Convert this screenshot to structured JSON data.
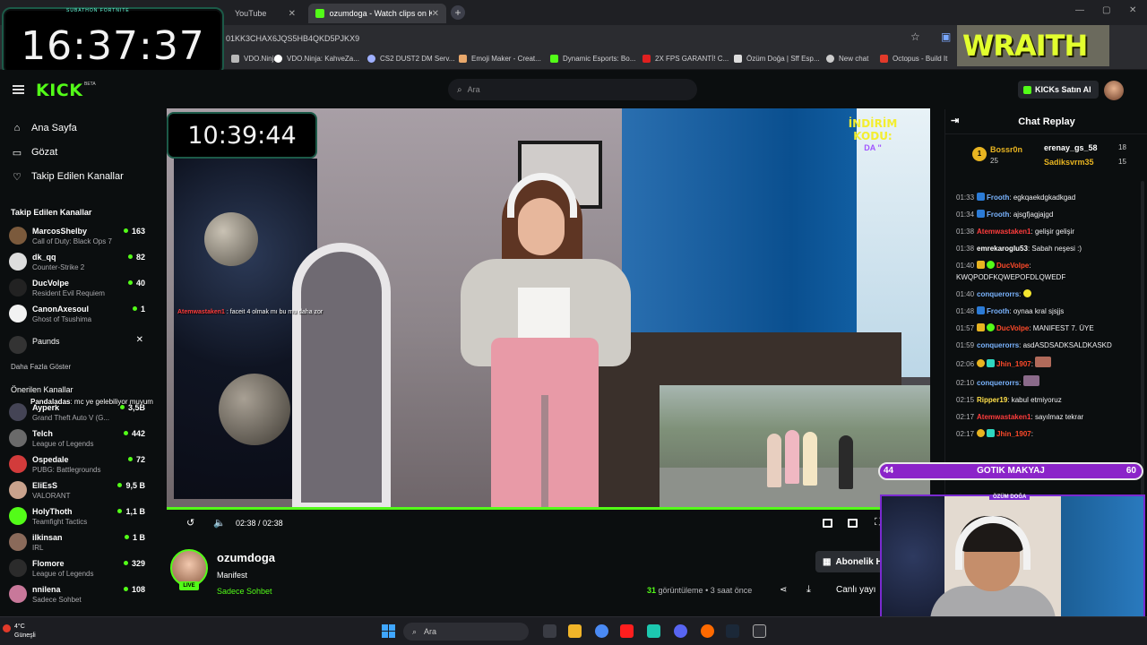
{
  "browser": {
    "tabs": [
      {
        "title": "YouTube",
        "active": false
      },
      {
        "title": "ozumdoga - Watch clips on Ki",
        "active": true
      }
    ],
    "url": "01KK3CHAX6JQS5HB4QKD5PJKX9",
    "bookmarks": [
      "VDO.Ninja",
      "VDO.Ninja: KahveZa...",
      "CS2 DUST2 DM Serv...",
      "Emoji Maker - Creat...",
      "Dynamic Esports: Bo...",
      "2X FPS GARANTİ! C...",
      "Özüm Doğa | Sff Esp...",
      "New chat",
      "Octopus - Build It"
    ]
  },
  "overlays": {
    "clock_top": "16:37:37",
    "clock_top_label": "SUBATHON FORTNITE",
    "logo_text": "WRAITH",
    "clock_player": "10:39:44",
    "promo_line1": "İNDİRİM KODU:",
    "promo_line2": "DA \""
  },
  "header": {
    "logo": "KICK",
    "logo_tag": "BETA",
    "search_placeholder": "Ara",
    "buy_label": "KICKs Satın Al"
  },
  "sidebar": {
    "nav": [
      {
        "label": "Ana Sayfa",
        "icon": "home-icon"
      },
      {
        "label": "Gözat",
        "icon": "compass-icon"
      },
      {
        "label": "Takip Edilen Kanallar",
        "icon": "heart-icon"
      }
    ],
    "followed_title": "Takip Edilen Kanallar",
    "followed": [
      {
        "name": "MarcosShelby",
        "game": "Call of Duty: Black Ops 7",
        "viewers": "163"
      },
      {
        "name": "dk_qq",
        "game": "Counter-Strike 2",
        "viewers": "82"
      },
      {
        "name": "DucVolpe",
        "game": "Resident Evil Requiem",
        "viewers": "40"
      },
      {
        "name": "CanonAxesoul",
        "game": "Ghost of Tsushima",
        "viewers": "1"
      },
      {
        "name": "Paunds",
        "game": "",
        "viewers": ""
      }
    ],
    "show_more": "Daha Fazla Göster",
    "recommended_title": "Önerilen Kanallar",
    "recommended": [
      {
        "name": "Ayperk",
        "game": "Grand Theft Auto V (G...",
        "viewers": "3,5B"
      },
      {
        "name": "Telch",
        "game": "League of Legends",
        "viewers": "442"
      },
      {
        "name": "Ospedale",
        "game": "PUBG: Battlegrounds",
        "viewers": "72"
      },
      {
        "name": "EliEsS",
        "game": "VALORANT",
        "viewers": "9,5 B"
      },
      {
        "name": "HolyThoth",
        "game": "Teamfight Tactics",
        "viewers": "1,1 B"
      },
      {
        "name": "ilkinsan",
        "game": "IRL",
        "viewers": "1 B"
      },
      {
        "name": "Flomore",
        "game": "League of Legends",
        "viewers": "329"
      },
      {
        "name": "nnilena",
        "game": "Sadece Sohbet",
        "viewers": "108"
      }
    ],
    "floating_chat_user": "Pandaladas",
    "floating_chat_text": ": mc ye gelebiliyor muyum"
  },
  "player": {
    "overlay_chat_user": "Atemwastaken1",
    "overlay_chat_text": ": faceit 4 olmak mı bu mu daha zor",
    "time_current": "02:38",
    "time_sep": "/",
    "time_total": "02:38",
    "progress": 1.0
  },
  "video_info": {
    "channel": "ozumdoga",
    "title": "Manifest",
    "category": "Sadece Sohbet",
    "live_badge": "LIVE",
    "views_count": "31",
    "views_label": "görüntüleme",
    "ago": "• 3 saat önce",
    "subscribe_label": "Abonelik H",
    "live_link": "Canlı yayı"
  },
  "chat": {
    "title": "Chat Replay",
    "top_gifters": [
      {
        "name": "Bossr0n",
        "count": "25",
        "color": "#e8b421"
      },
      {
        "name": "erenay_gs_58",
        "count": "18",
        "color": "#ffffff"
      },
      {
        "name": "Sadiksvrm35",
        "count": "15",
        "color": "#e8b421"
      }
    ],
    "messages": [
      {
        "ts": "01:33",
        "user": "Frooth",
        "color": "#7ab4ff",
        "text": "egkqaekdgkadkgad"
      },
      {
        "ts": "01:34",
        "user": "Frooth",
        "color": "#7ab4ff",
        "text": "ajsgfjagjajgd"
      },
      {
        "ts": "01:38",
        "user": "Atemwastaken1",
        "color": "#ff3c3c",
        "text": "gelişir gelişir"
      },
      {
        "ts": "01:38",
        "user": "emrekaroglu53",
        "color": "#ffffff",
        "text": "Sabah neşesi :)"
      },
      {
        "ts": "01:40",
        "user": "DucVolpe",
        "color": "#ff4a2a",
        "text": "KWQPODFKQWEPOFDLQWEDF"
      },
      {
        "ts": "01:40",
        "user": "conquerorrs",
        "color": "#7ab4ff",
        "text": ""
      },
      {
        "ts": "01:48",
        "user": "Frooth",
        "color": "#7ab4ff",
        "text": "oynaa kral sjsjjs"
      },
      {
        "ts": "01:57",
        "user": "DucVolpe",
        "color": "#ff4a2a",
        "text": "MANIFEST 7. ÜYE"
      },
      {
        "ts": "01:59",
        "user": "conquerorrs",
        "color": "#7ab4ff",
        "text": "asdASDSADKSALDKASKD"
      },
      {
        "ts": "02:06",
        "user": "Jhin_1907",
        "color": "#ff4a2a",
        "text": ""
      },
      {
        "ts": "02:10",
        "user": "conquerorrs",
        "color": "#7ab4ff",
        "text": ""
      },
      {
        "ts": "02:15",
        "user": "Ripper19",
        "color": "#ffe04a",
        "text": "kabul etmiyoruz"
      },
      {
        "ts": "02:17",
        "user": "Atemwastaken1",
        "color": "#ff3c3c",
        "text": "sayılmaz tekrar"
      },
      {
        "ts": "02:17",
        "user": "Jhin_1907",
        "color": "#ff4a2a",
        "text": ""
      }
    ]
  },
  "goal": {
    "left": "44",
    "label": "GOTIK MAKYAJ",
    "right": "60"
  },
  "cam_label": "ÖZÜM DOĞA",
  "taskbar": {
    "temp": "4°C",
    "weather": "Güneşli",
    "search_placeholder": "Ara"
  },
  "colors": {
    "accent": "#53fc18",
    "goal": "#8b24c9"
  }
}
